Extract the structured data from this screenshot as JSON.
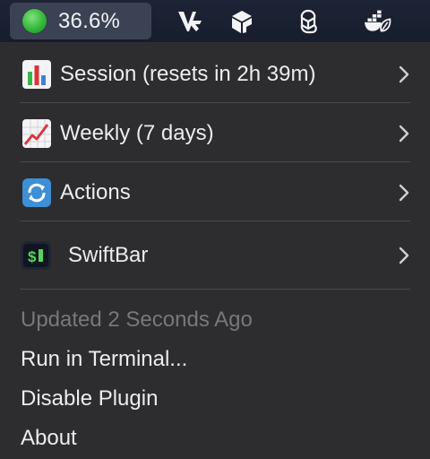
{
  "menubar": {
    "status_text": "36.6%",
    "status_icon": "green-circle",
    "tray_icons": [
      "vuejs-style-logo-icon",
      "cube-app-icon",
      "openai-logo-icon",
      "docker-leaf-icon"
    ]
  },
  "menu": {
    "items": [
      {
        "icon": "bar-chart-icon",
        "label": "Session (resets in 2h 39m)",
        "submenu": true
      },
      {
        "icon": "chart-increasing-icon",
        "label": "Weekly (7 days)",
        "submenu": true
      },
      {
        "icon": "refresh-arrows-icon",
        "label": "Actions",
        "submenu": true
      },
      {
        "icon": "swiftbar-app-icon",
        "label": "SwiftBar",
        "submenu": true
      }
    ],
    "updated_text": "Updated 2 Seconds Ago",
    "footer_items": [
      "Run in Terminal...",
      "Disable Plugin",
      "About"
    ]
  },
  "colors": {
    "menubar_bg": "#1b2233",
    "menu_bg": "#2d2d30",
    "status_dot": "#2fb236",
    "text": "#ececee",
    "dim_text": "#77777c"
  }
}
